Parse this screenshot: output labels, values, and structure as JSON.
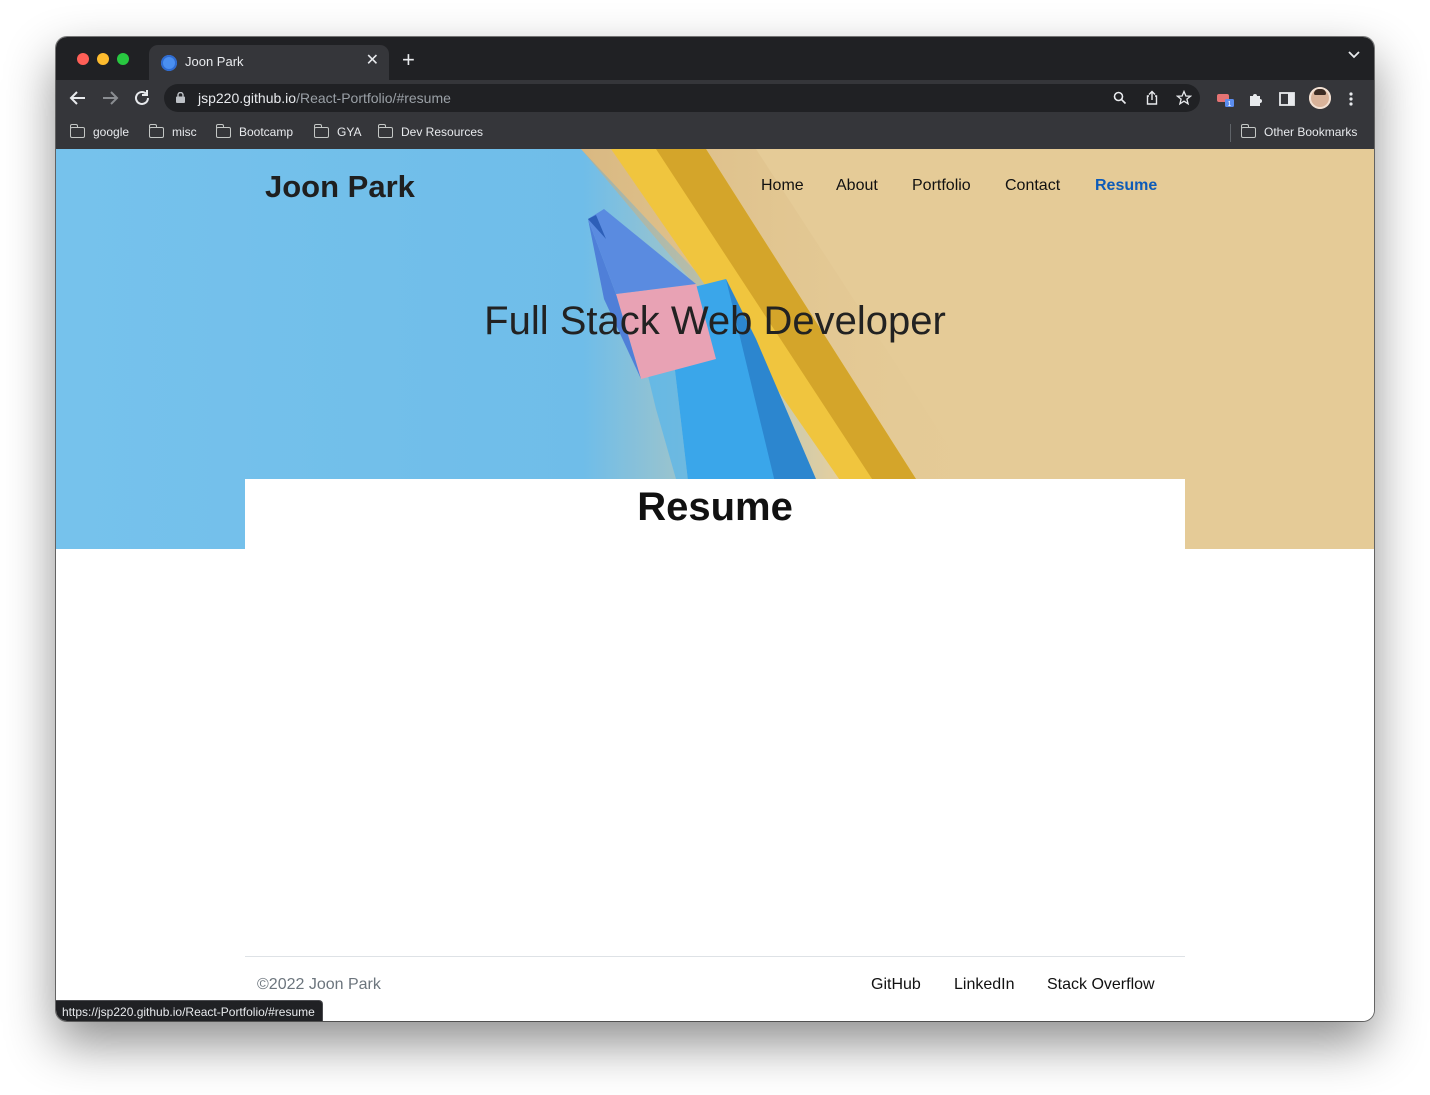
{
  "browser": {
    "tab_title": "Joon Park",
    "tab_close": "✕",
    "new_tab": "+",
    "url_host": "jsp220.github.io",
    "url_path": "/React-Portfolio/#resume",
    "bookmarks": [
      "google",
      "misc",
      "Bootcamp",
      "GYA",
      "Dev Resources"
    ],
    "other_bookmarks": "Other Bookmarks",
    "extension_badge": "1",
    "status_url": "https://jsp220.github.io/React-Portfolio/#resume"
  },
  "site": {
    "brand": "Joon Park",
    "nav": [
      "Home",
      "About",
      "Portfolio",
      "Contact",
      "Resume"
    ],
    "active_nav": "Resume",
    "hero_title": "Full Stack Web Developer",
    "section_heading": "Resume"
  },
  "footer": {
    "copyright": "©2022 Joon Park",
    "links": [
      "GitHub",
      "LinkedIn",
      "Stack Overflow"
    ]
  },
  "colors": {
    "chrome_dark": "#202124",
    "chrome_toolbar": "#35363a",
    "active_nav": "#0d5bb8",
    "hero_blue": "#74c1eb",
    "hero_tan": "#e4c890"
  }
}
